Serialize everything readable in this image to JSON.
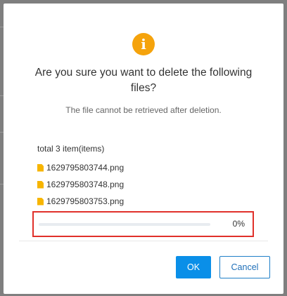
{
  "dialog": {
    "icon": "info-icon",
    "icon_glyph": "i",
    "title": "Are you sure you want to delete the following files?",
    "subtitle": "The file cannot be retrieved after deletion.",
    "total_label": "total 3 item(items)",
    "files": [
      {
        "name": "1629795803744.png",
        "icon": "file-icon"
      },
      {
        "name": "1629795803748.png",
        "icon": "file-icon"
      },
      {
        "name": "1629795803753.png",
        "icon": "file-icon"
      }
    ],
    "progress": {
      "value": 0,
      "label": "0%"
    },
    "ok_label": "OK",
    "cancel_label": "Cancel"
  },
  "colors": {
    "icon": "#f5a30c",
    "file_icon": "#f7b500",
    "primary": "#0a8fe8",
    "highlight_border": "#e0302a"
  }
}
